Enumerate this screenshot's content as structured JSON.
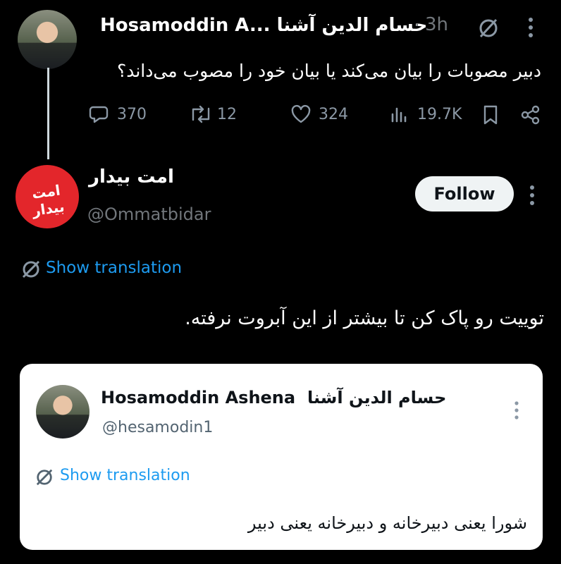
{
  "top_tweet": {
    "author_display": "Hosamoddin A... حسام الدين آشنا",
    "separator": "·",
    "time": "3h",
    "text": "دبیر مصوبات را بیان می‌کند یا بیان خود را مصوب می‌داند؟",
    "stats": {
      "replies": "370",
      "retweets": "12",
      "likes": "324",
      "views": "19.7K"
    }
  },
  "reply_tweet": {
    "author_name": "امت بیدار",
    "handle": "@Ommatbidar",
    "follow_label": "Follow",
    "avatar_logo_text": "امت بیدار",
    "show_translation": "Show translation",
    "text": "توییت رو پاک کن تا بیشتر از این آبروت نرفته."
  },
  "quoted_tweet": {
    "author_name": "Hosamoddin Ashena",
    "author_name_fa": "حسام الدين آشنا",
    "handle": "@hesamodin1",
    "show_translation": "Show translation",
    "text": "شورا یعنی دبیرخانه و دبیرخانه یعنی دبیر"
  },
  "colors": {
    "background": "#000000",
    "link": "#1d9bf0",
    "muted": "#71767b",
    "logo_red": "#e3262b"
  }
}
